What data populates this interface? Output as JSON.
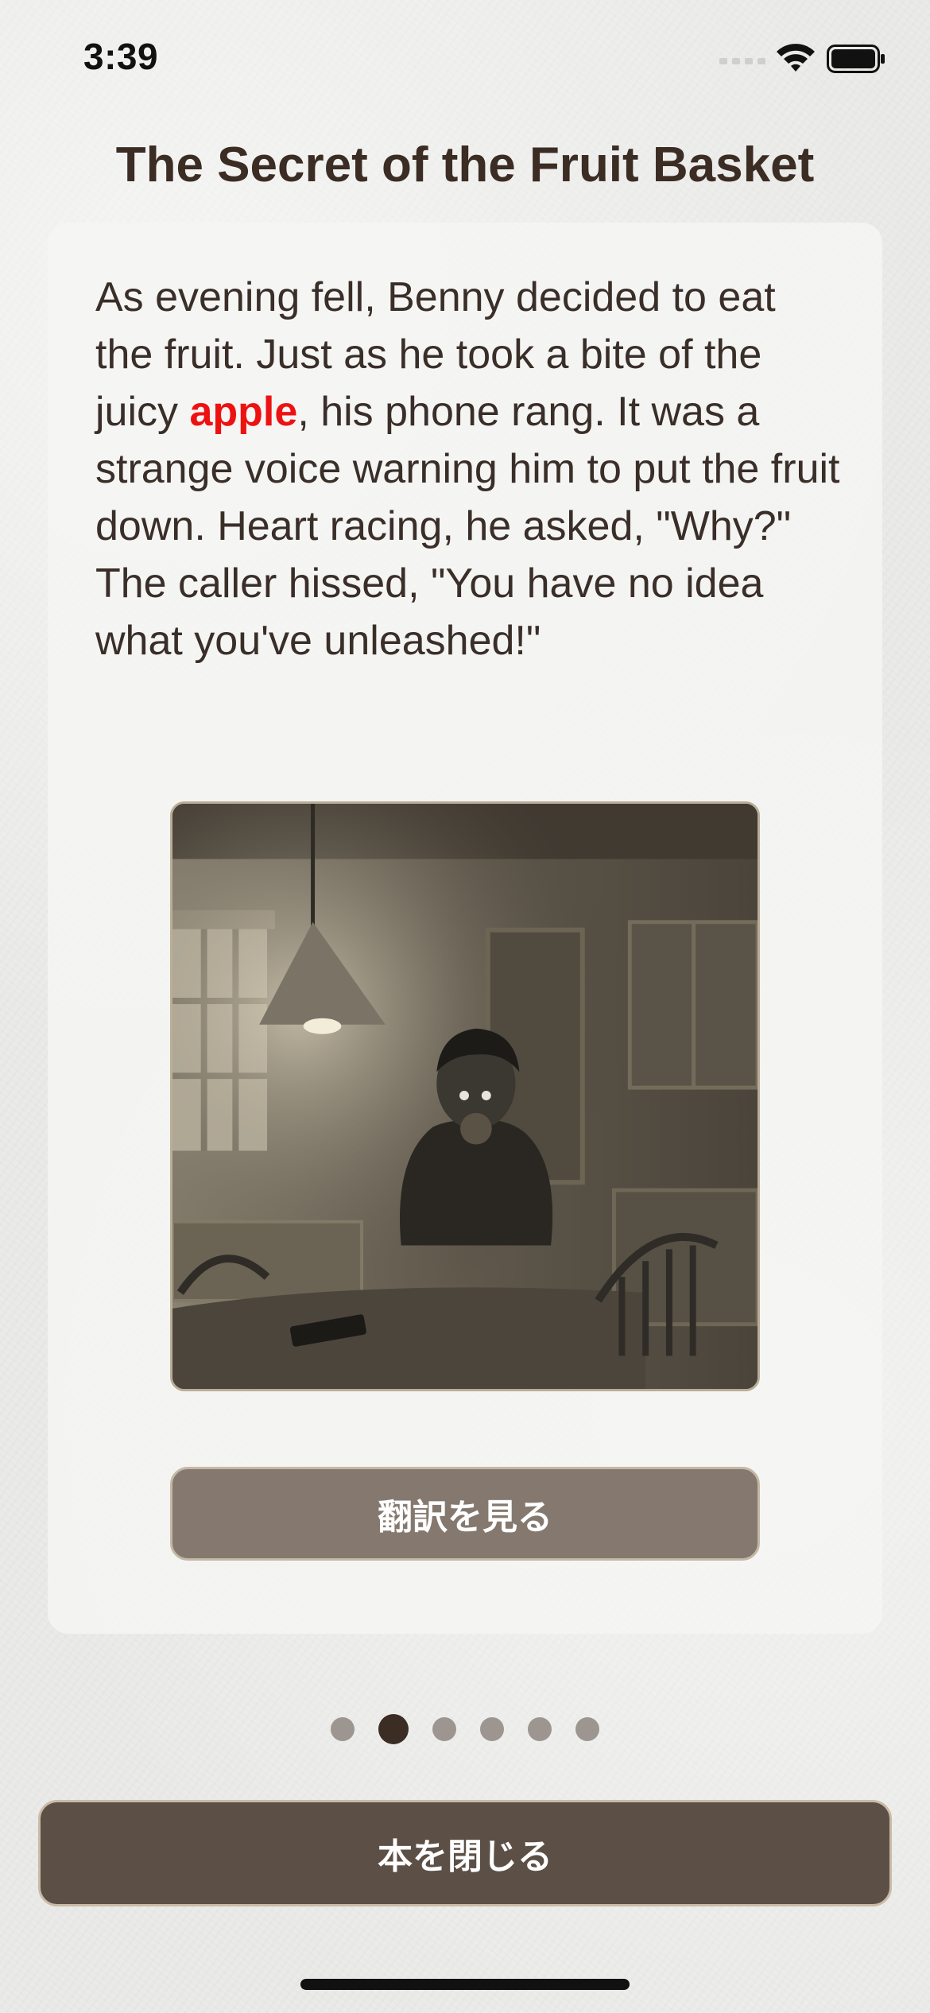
{
  "status_bar": {
    "time": "3:39"
  },
  "story": {
    "title": "The Secret of the Fruit Basket",
    "text_before": "As evening fell, Benny decided to eat the fruit. Just as he took a bite of the juicy ",
    "highlight_word": "apple",
    "text_after": ", his phone rang. It was a strange voice warning him to put the fruit down. Heart racing, he asked, \"Why?\" The caller hissed, \"You have no idea what you've unleashed!\"",
    "highlight_color": "#ee1111"
  },
  "buttons": {
    "translate_label": "翻訳を見る",
    "close_label": "本を閉じる"
  },
  "pager": {
    "total_pages": 6,
    "current_page": 2
  },
  "icons": [
    "cellular-signal-icon",
    "wifi-icon",
    "battery-icon"
  ]
}
